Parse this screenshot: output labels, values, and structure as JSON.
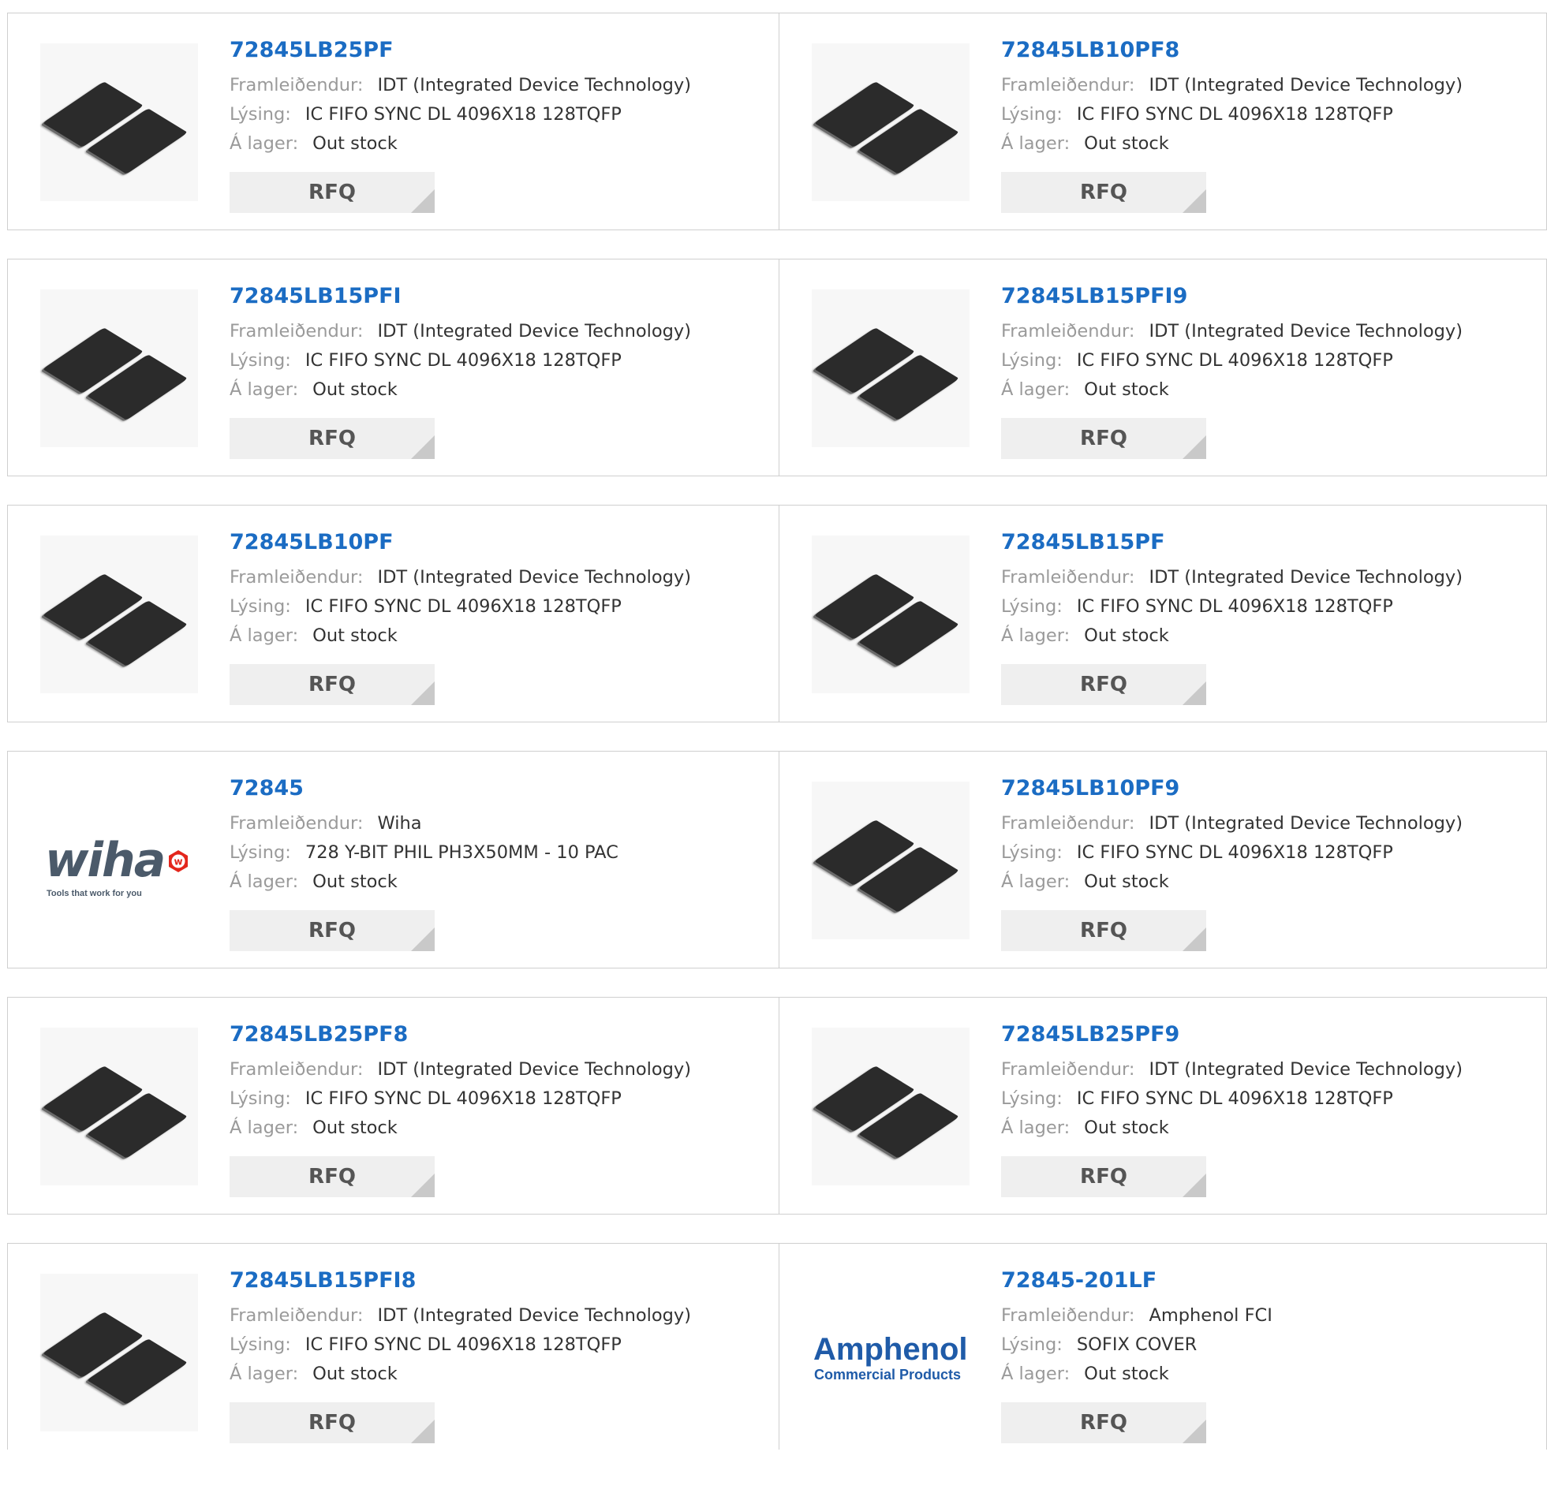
{
  "labels": {
    "manufacturer": "Framleiðendur:",
    "description": "Lýsing:",
    "stock": "Á lager:",
    "rfq": "RFQ"
  },
  "products": [
    {
      "pn": "72845LB25PF",
      "manufacturer": "IDT (Integrated Device Technology)",
      "description": "IC FIFO SYNC DL 4096X18 128TQFP",
      "stock": "Out stock",
      "image": "tqfp-chip-image"
    },
    {
      "pn": "72845LB10PF8",
      "manufacturer": "IDT (Integrated Device Technology)",
      "description": "IC FIFO SYNC DL 4096X18 128TQFP",
      "stock": "Out stock",
      "image": "tqfp-chip-image"
    },
    {
      "pn": "72845LB15PFI",
      "manufacturer": "IDT (Integrated Device Technology)",
      "description": "IC FIFO SYNC DL 4096X18 128TQFP",
      "stock": "Out stock",
      "image": "tqfp-chip-image"
    },
    {
      "pn": "72845LB15PFI9",
      "manufacturer": "IDT (Integrated Device Technology)",
      "description": "IC FIFO SYNC DL 4096X18 128TQFP",
      "stock": "Out stock",
      "image": "tqfp-chip-image"
    },
    {
      "pn": "72845LB10PF",
      "manufacturer": "IDT (Integrated Device Technology)",
      "description": "IC FIFO SYNC DL 4096X18 128TQFP",
      "stock": "Out stock",
      "image": "tqfp-chip-image"
    },
    {
      "pn": "72845LB15PF",
      "manufacturer": "IDT (Integrated Device Technology)",
      "description": "IC FIFO SYNC DL 4096X18 128TQFP",
      "stock": "Out stock",
      "image": "tqfp-chip-image"
    },
    {
      "pn": "72845",
      "manufacturer": "Wiha",
      "description": "728 Y-BIT PHIL PH3X50MM - 10 PAC",
      "stock": "Out stock",
      "image": "wiha-logo",
      "logo_text": "wiha",
      "logo_tagline": "Tools that work for you"
    },
    {
      "pn": "72845LB10PF9",
      "manufacturer": "IDT (Integrated Device Technology)",
      "description": "IC FIFO SYNC DL 4096X18 128TQFP",
      "stock": "Out stock",
      "image": "tqfp-chip-image"
    },
    {
      "pn": "72845LB25PF8",
      "manufacturer": "IDT (Integrated Device Technology)",
      "description": "IC FIFO SYNC DL 4096X18 128TQFP",
      "stock": "Out stock",
      "image": "tqfp-chip-image"
    },
    {
      "pn": "72845LB25PF9",
      "manufacturer": "IDT (Integrated Device Technology)",
      "description": "IC FIFO SYNC DL 4096X18 128TQFP",
      "stock": "Out stock",
      "image": "tqfp-chip-image"
    },
    {
      "pn": "72845LB15PFI8",
      "manufacturer": "IDT (Integrated Device Technology)",
      "description": "IC FIFO SYNC DL 4096X18 128TQFP",
      "stock": "Out stock",
      "image": "tqfp-chip-image"
    },
    {
      "pn": "72845-201LF",
      "manufacturer": "Amphenol FCI",
      "description": "SOFIX COVER",
      "stock": "Out stock",
      "image": "amphenol-logo",
      "logo_text": "Amphenol",
      "logo_tagline": "Commercial Products"
    }
  ],
  "colors": {
    "link": "#1b6cc3",
    "label": "#9a9a9a",
    "value": "#333333",
    "border": "#cfcfcf",
    "rfq_bg": "#efefef"
  }
}
